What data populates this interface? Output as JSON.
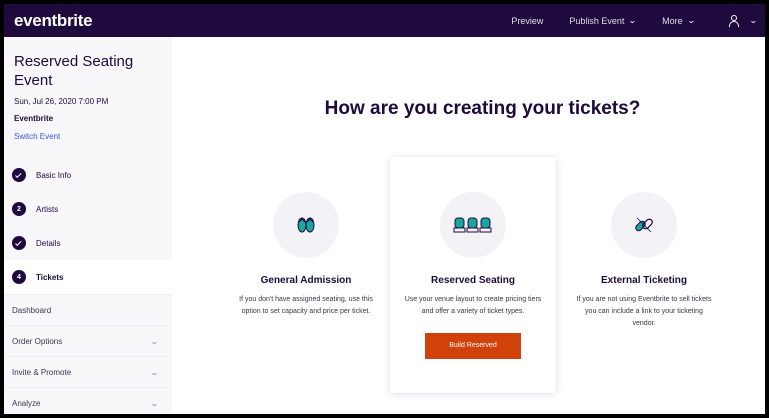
{
  "topbar": {
    "logo": "eventbrite",
    "preview": "Preview",
    "publish": "Publish Event",
    "more": "More"
  },
  "sidebar": {
    "event_title": "Reserved Seating Event",
    "event_date": "Sun, Jul 26, 2020 7:00 PM",
    "organizer": "Eventbrite",
    "switch_event": "Switch Event",
    "steps": [
      {
        "label": "Basic Info",
        "status": "done"
      },
      {
        "label": "Artists",
        "number": "2"
      },
      {
        "label": "Details",
        "status": "done"
      },
      {
        "label": "Tickets",
        "number": "4",
        "active": true
      }
    ],
    "menu": [
      {
        "label": "Dashboard"
      },
      {
        "label": "Order Options"
      },
      {
        "label": "Invite & Promote"
      },
      {
        "label": "Analyze"
      }
    ]
  },
  "main": {
    "heading": "How are you creating your tickets?",
    "cards": [
      {
        "title": "General Admission",
        "description": "If you don't have assigned seating, use this option to set capacity and price per ticket.",
        "icon": "flip-flops-icon"
      },
      {
        "title": "Reserved Seating",
        "description": "Use your venue layout to create pricing tiers and offer a variety of ticket types.",
        "icon": "theater-seats-icon",
        "button": "Build Reserved"
      },
      {
        "title": "External Ticketing",
        "description": "If you are not using Eventbrite to sell tickets you can include a link to your ticketing vendor.",
        "icon": "chain-link-icon"
      }
    ]
  },
  "colors": {
    "topbar_bg": "#1e0a3c",
    "link": "#3659e3",
    "primary_button": "#d1410c",
    "accent_teal": "#1aa6a0"
  }
}
